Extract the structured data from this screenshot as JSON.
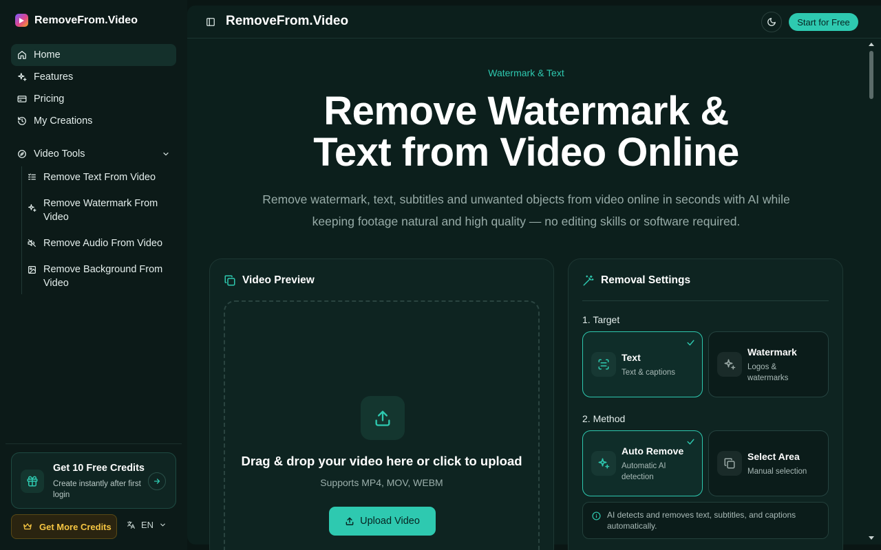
{
  "brand": {
    "name": "RemoveFrom.Video"
  },
  "nav": {
    "items": [
      {
        "label": "Home",
        "icon": "home-icon"
      },
      {
        "label": "Features",
        "icon": "sparkles-icon"
      },
      {
        "label": "Pricing",
        "icon": "credit-card-icon"
      },
      {
        "label": "My Creations",
        "icon": "history-icon"
      }
    ]
  },
  "video_tools": {
    "label": "Video Tools",
    "items": [
      {
        "label": "Remove Text From Video",
        "icon": "list-icon"
      },
      {
        "label": "Remove Watermark From Video",
        "icon": "sparkles-icon"
      },
      {
        "label": "Remove Audio From Video",
        "icon": "volume-off-icon"
      },
      {
        "label": "Remove Background From Video",
        "icon": "image-icon"
      }
    ]
  },
  "credits": {
    "title": "Get 10 Free Credits",
    "subtitle": "Create instantly after first login",
    "more_label": "Get More Credits",
    "lang": "EN"
  },
  "topbar": {
    "title": "RemoveFrom.Video",
    "start_label": "Start for Free"
  },
  "hero": {
    "eyebrow": "Watermark & Text",
    "title_line1": "Remove Watermark &",
    "title_line2": "Text from Video Online",
    "subtitle": "Remove watermark, text, subtitles and unwanted objects from video online in seconds with AI while keeping footage natural and high quality — no editing skills or software required."
  },
  "preview": {
    "heading": "Video Preview",
    "drop_title": "Drag & drop your video here or click to upload",
    "drop_sub": "Supports MP4, MOV, WEBM",
    "upload_label": "Upload Video"
  },
  "settings": {
    "heading": "Removal Settings",
    "target_label": "1. Target",
    "target_options": [
      {
        "title": "Text",
        "desc": "Text & captions",
        "selected": true
      },
      {
        "title": "Watermark",
        "desc": "Logos & watermarks",
        "selected": false
      }
    ],
    "method_label": "2. Method",
    "method_options": [
      {
        "title": "Auto Remove",
        "desc": "Automatic AI detection",
        "selected": true
      },
      {
        "title": "Select Area",
        "desc": "Manual selection",
        "selected": false
      }
    ],
    "info": "AI detects and removes text, subtitles, and captions automatically."
  },
  "colors": {
    "accent": "#2ec9b0",
    "gold": "#f5c542",
    "background": "#0a1614"
  }
}
